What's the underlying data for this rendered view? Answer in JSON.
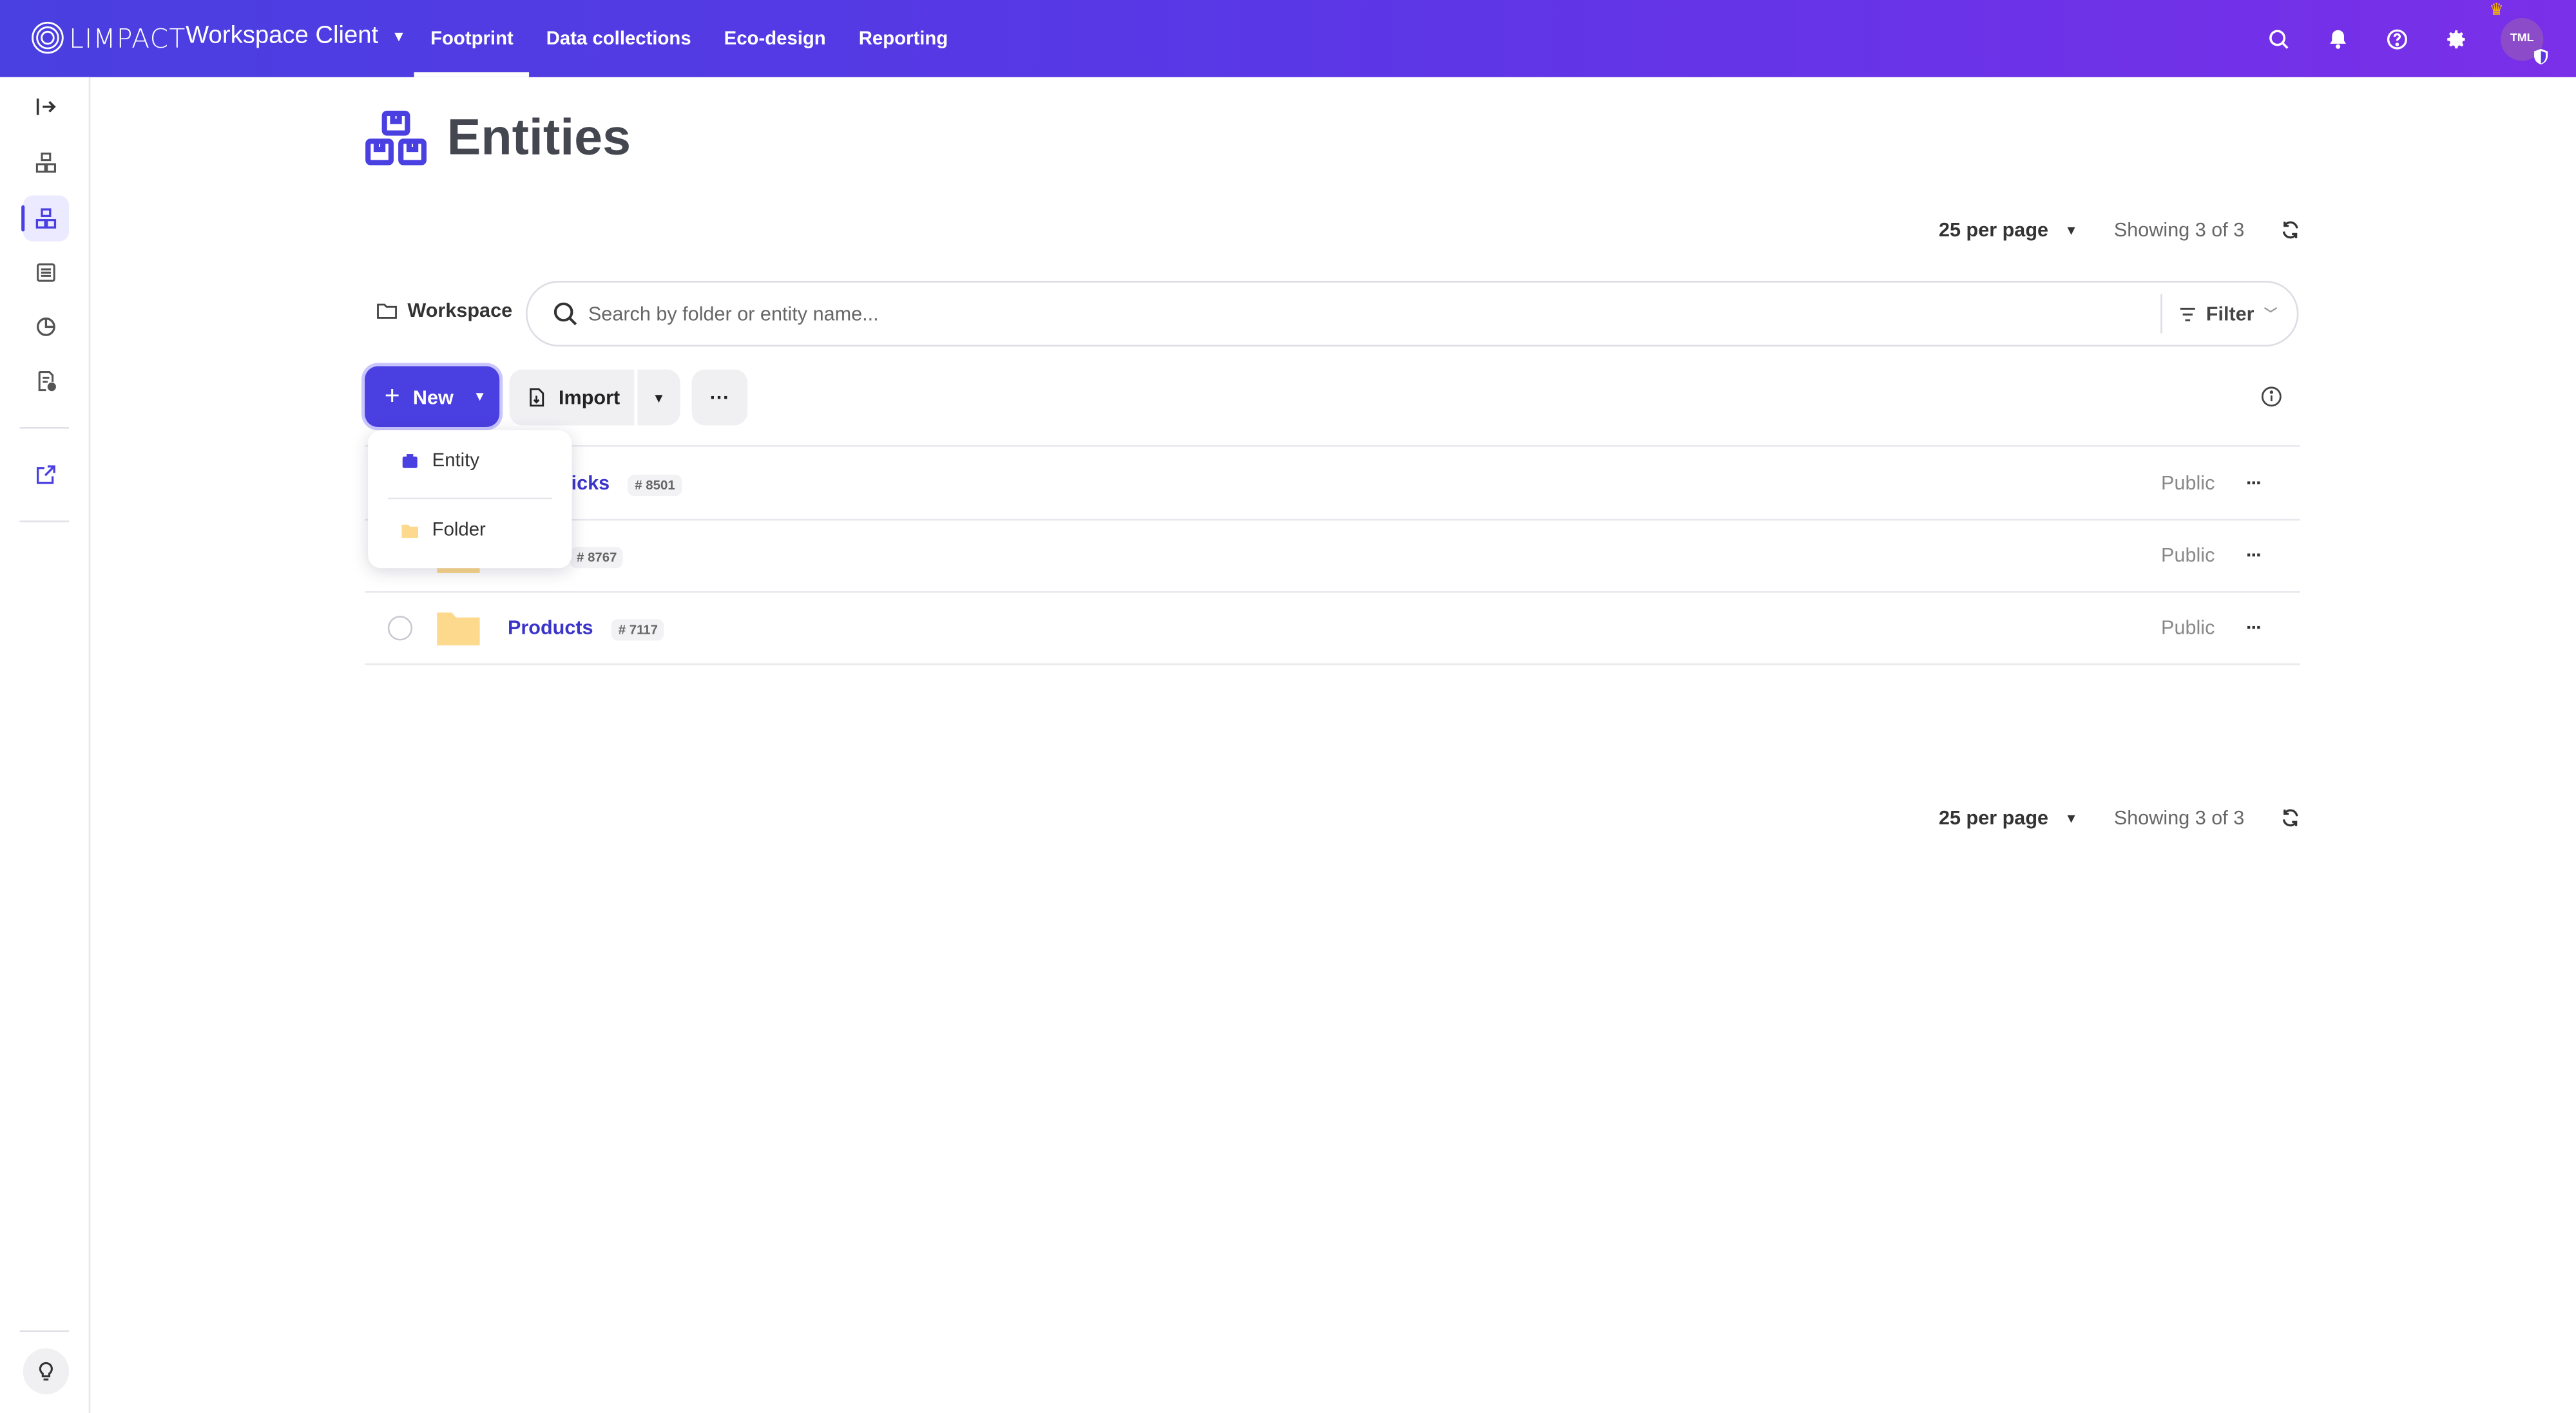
{
  "app": {
    "logo_text": "LIMPACT",
    "workspace_title": "Workspace Client"
  },
  "nav": {
    "links": [
      "Footprint",
      "Data collections",
      "Eco-design",
      "Reporting"
    ],
    "active": "Footprint"
  },
  "user": {
    "initials": "TML"
  },
  "page": {
    "title": "Entities"
  },
  "pagination_top": {
    "per_page": "25 per page",
    "showing": "Showing 3 of 3"
  },
  "pagination_bottom": {
    "per_page": "25 per page",
    "showing": "Showing 3 of 3"
  },
  "breadcrumb": {
    "label": "Workspace"
  },
  "search": {
    "placeholder": "Search by folder or entity name...",
    "value": "",
    "filter_label": "Filter"
  },
  "toolbar": {
    "new_label": "New",
    "import_label": "Import"
  },
  "new_menu": {
    "items": [
      "Entity",
      "Folder"
    ]
  },
  "rows": [
    {
      "name": "tary Bricks",
      "id": "# 8501",
      "visibility": "Public"
    },
    {
      "name": "",
      "id": "# 8767",
      "visibility": "Public"
    },
    {
      "name": "Products",
      "id": "# 7117",
      "visibility": "Public"
    }
  ],
  "colors": {
    "brand": "#4a3fe0",
    "brand_gradient_end": "#7a2fe8",
    "folder": "#fcd98c",
    "link": "#3b34c9"
  },
  "icons": [
    "glimpact-logo-icon",
    "search-icon",
    "bell-icon",
    "help-icon",
    "gear-icon",
    "shield-icon",
    "collapse-sidebar-icon",
    "entities-icon",
    "list-icon",
    "chart-icon",
    "report-icon",
    "external-link-icon",
    "lightbulb-icon",
    "folder-icon",
    "refresh-icon",
    "filter-icon",
    "file-icon",
    "info-icon"
  ]
}
